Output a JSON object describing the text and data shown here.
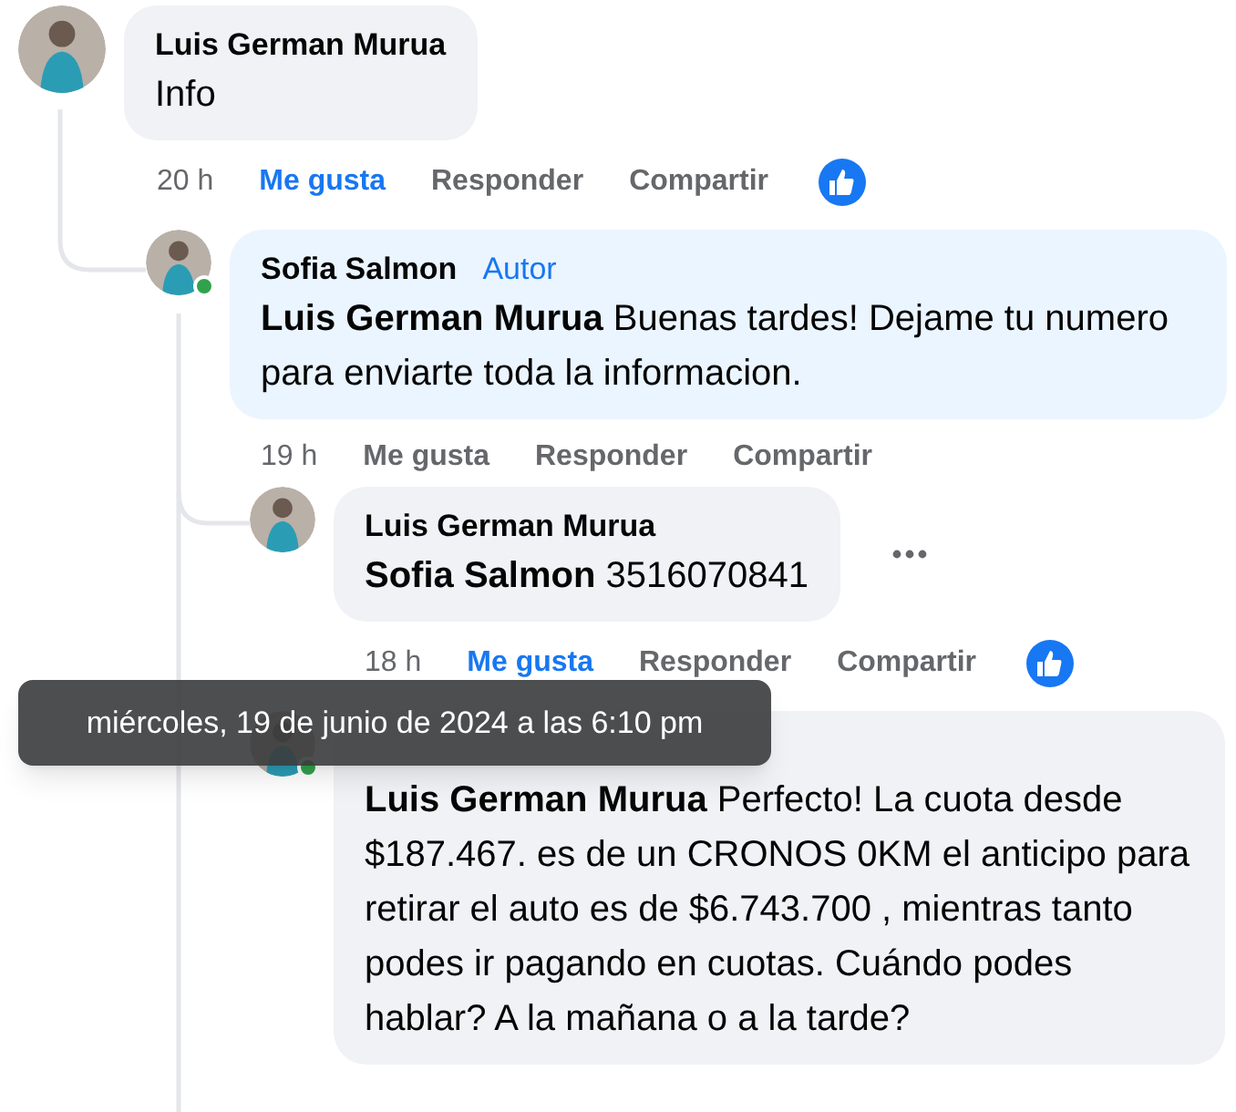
{
  "comments": [
    {
      "author": "Luis German Murua",
      "text": "Info",
      "like_reaction": true,
      "time": "20 h",
      "actions": [
        {
          "label": "Me gusta",
          "selected": true
        },
        {
          "label": "Responder",
          "selected": false
        },
        {
          "label": "Compartir",
          "selected": false
        }
      ],
      "children": [
        {
          "author": "Sofia Salmon",
          "badge": "Autor",
          "text": "**Luis German Murua** Buenas tardes! Dejame tu numero para enviarte toda la informacion.",
          "online": true,
          "time": "19 h",
          "actions": [
            {
              "label": "Me gusta",
              "selected": false
            },
            {
              "label": "Responder",
              "selected": false
            },
            {
              "label": "Compartir",
              "selected": false
            }
          ],
          "children": [
            {
              "author": "Luis German Murua",
              "text": "**Sofia Salmon** 3516070841",
              "more_menu": true,
              "like_reaction": true,
              "time": "18 h",
              "actions": [
                {
                  "label": "Me gusta",
                  "selected": true
                },
                {
                  "label": "Responder",
                  "selected": false
                },
                {
                  "label": "Compartir",
                  "selected": false
                }
              ]
            },
            {
              "text": "**Luis German Murua** Perfecto! La cuota desde $187.467. es de un CRONOS 0KM el anticipo para retirar el auto es de $6.743.700 , mientras tanto podes ir pagando en cuotas. Cuándo podes hablar? A la mañana o a la tarde?",
              "online": true
            }
          ]
        }
      ]
    }
  ],
  "tooltip": {
    "text": "miércoles, 19 de junio de 2024 a las 6:10 pm"
  }
}
